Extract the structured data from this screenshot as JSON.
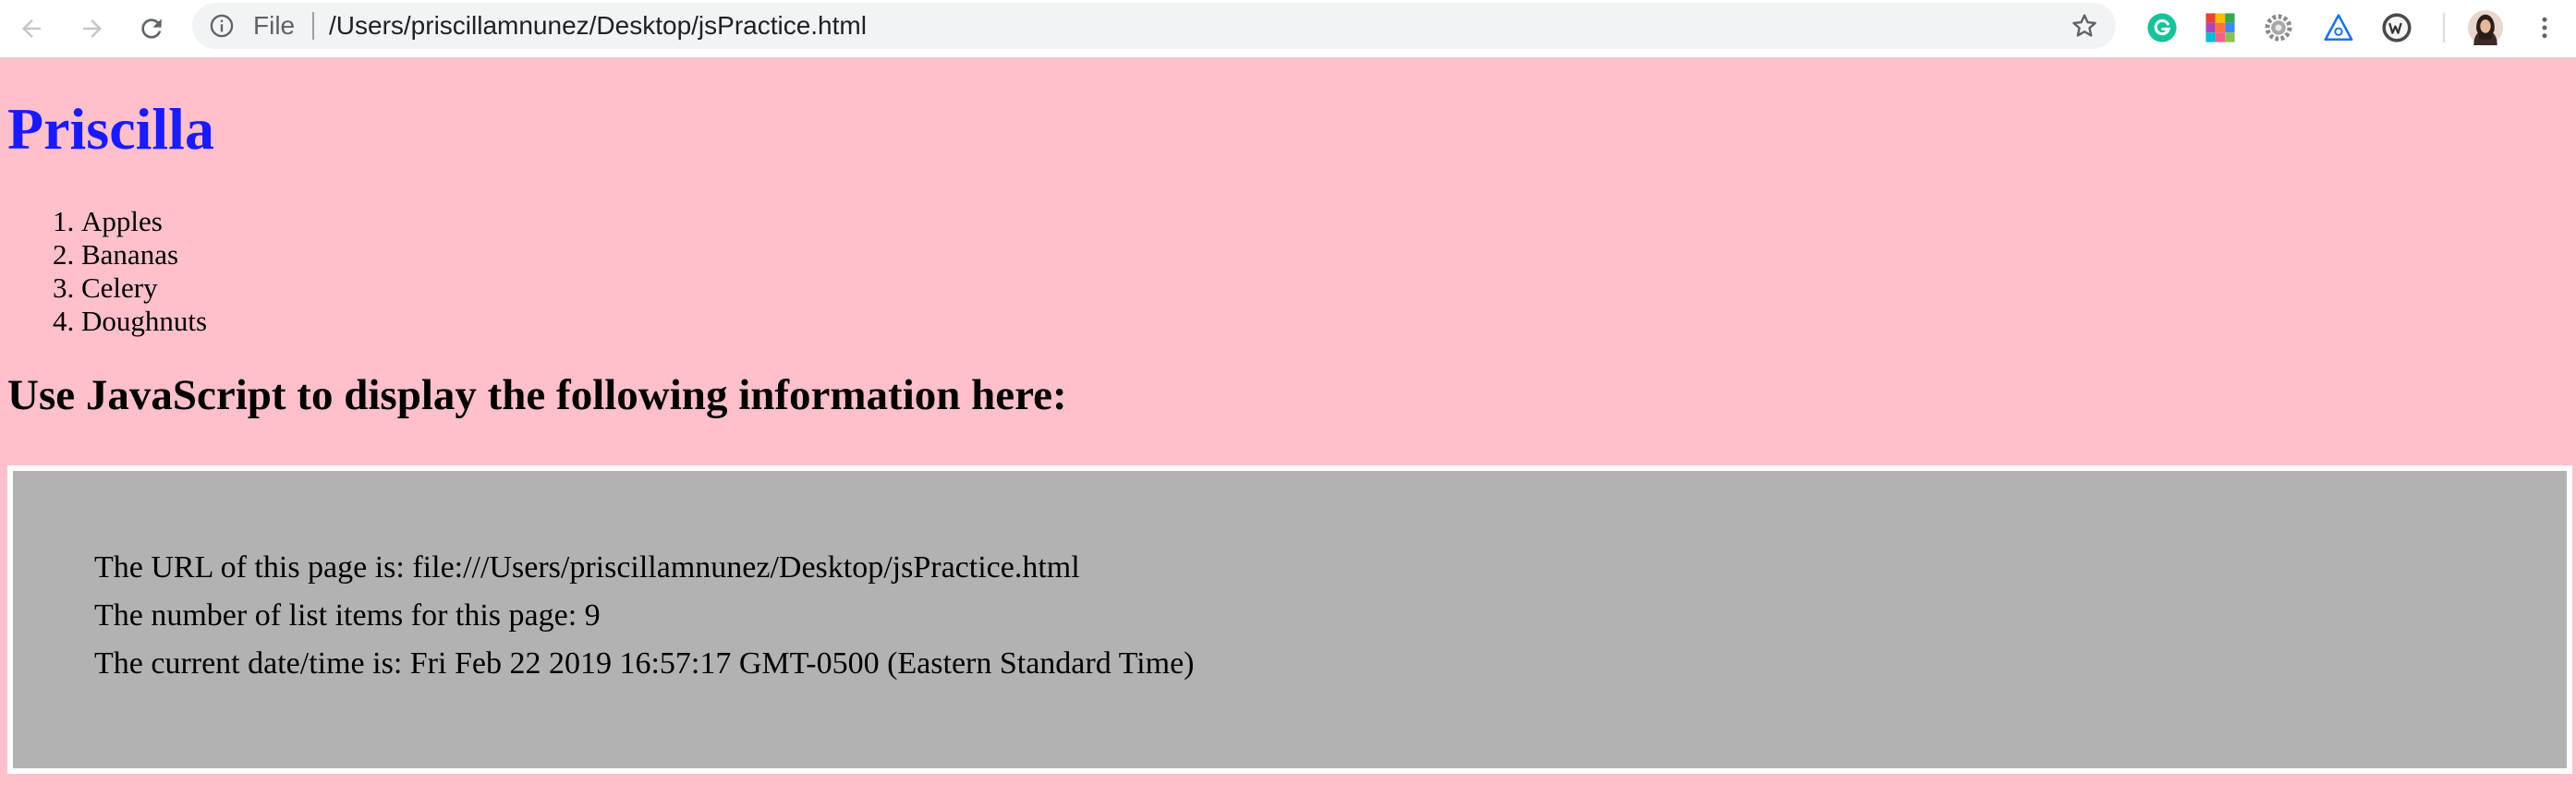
{
  "browser": {
    "scheme_label": "File",
    "url": "/Users/priscillamnunez/Desktop/jsPractice.html",
    "extensions": [
      "grammarly-icon",
      "color-palette-icon",
      "settings-gear-icon",
      "triangle-extension-icon",
      "w-extension-icon"
    ],
    "colors": {
      "toolbar": "#ffffff",
      "omnibox": "#f1f3f4"
    }
  },
  "page": {
    "title": "Priscilla",
    "list_items": [
      "Apples",
      "Bananas",
      "Celery",
      "Doughnuts"
    ],
    "prompt": "Use JavaScript to display the following information here:",
    "info_lines": [
      "The URL of this page is: file:///Users/priscillamnunez/Desktop/jsPractice.html",
      "The number of list items for this page: 9",
      "The current date/time is: Fri Feb 22 2019 16:57:17 GMT-0500 (Eastern Standard Time)"
    ],
    "colors": {
      "background": "#ffc0cb",
      "title": "#1a1aff",
      "box": "#b2b2b2",
      "box_border": "#ffffff"
    }
  }
}
